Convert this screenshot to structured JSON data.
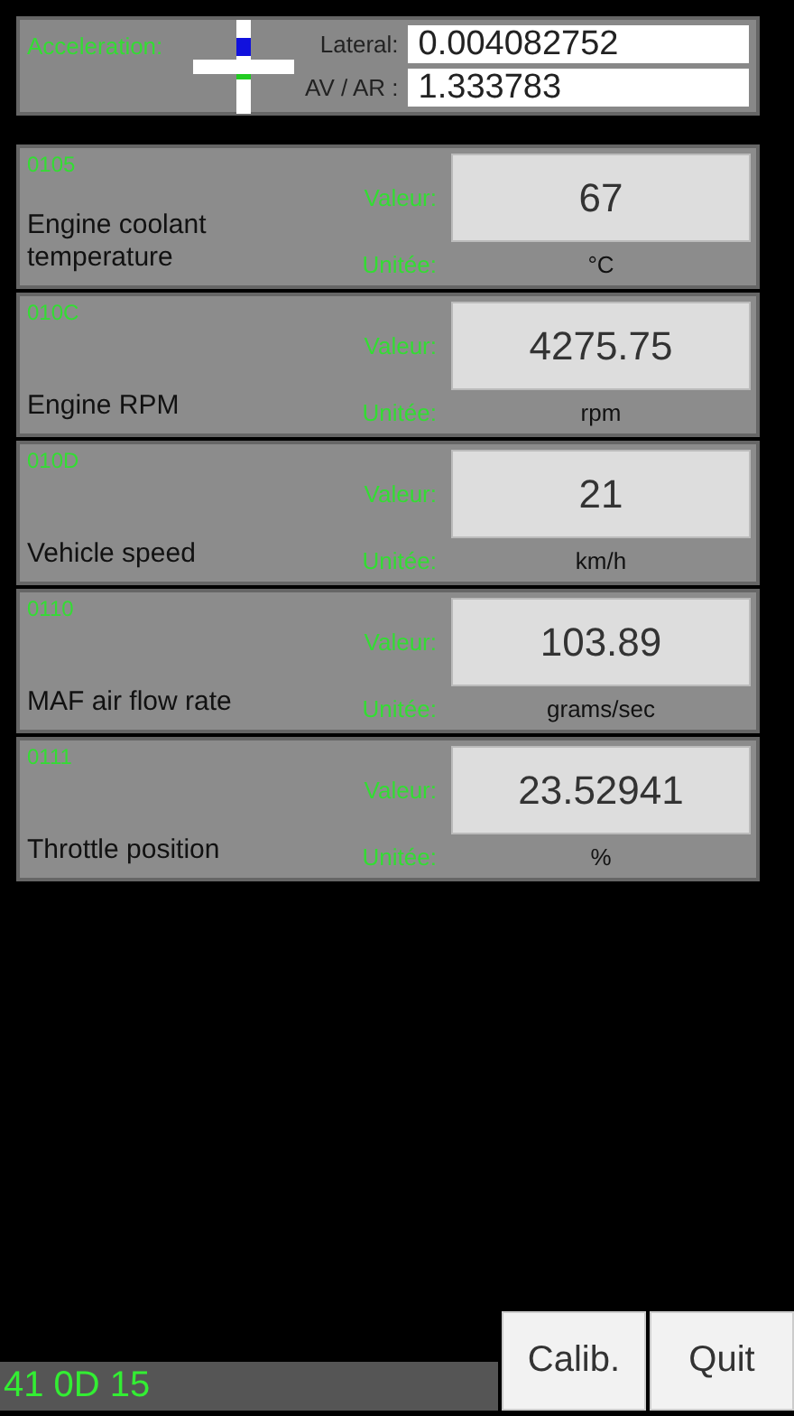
{
  "acceleration": {
    "label": "Acceleration:",
    "lateral_label": "Lateral:",
    "lateral": "0.004082752",
    "avar_label": "AV / AR :",
    "avar": "1.333783"
  },
  "pids": [
    {
      "code": "0105",
      "name": "Engine coolant temperature",
      "value_label": "Valeur:",
      "value": "67",
      "unit_label": "Unitée:",
      "unit": "°C"
    },
    {
      "code": "010C",
      "name": "Engine RPM",
      "value_label": "Valeur:",
      "value": "4275.75",
      "unit_label": "Unitée:",
      "unit": "rpm"
    },
    {
      "code": "010D",
      "name": "Vehicle speed",
      "value_label": "Valeur:",
      "value": "21",
      "unit_label": "Unitée:",
      "unit": "km/h"
    },
    {
      "code": "0110",
      "name": "MAF air flow rate",
      "value_label": "Valeur:",
      "value": "103.89",
      "unit_label": "Unitée:",
      "unit": "grams/sec"
    },
    {
      "code": "0111",
      "name": "Throttle position",
      "value_label": "Valeur:",
      "value": "23.52941",
      "unit_label": "Unitée:",
      "unit": "%"
    }
  ],
  "status": "41 0D 15",
  "buttons": [
    "Calib.",
    "Quit"
  ]
}
